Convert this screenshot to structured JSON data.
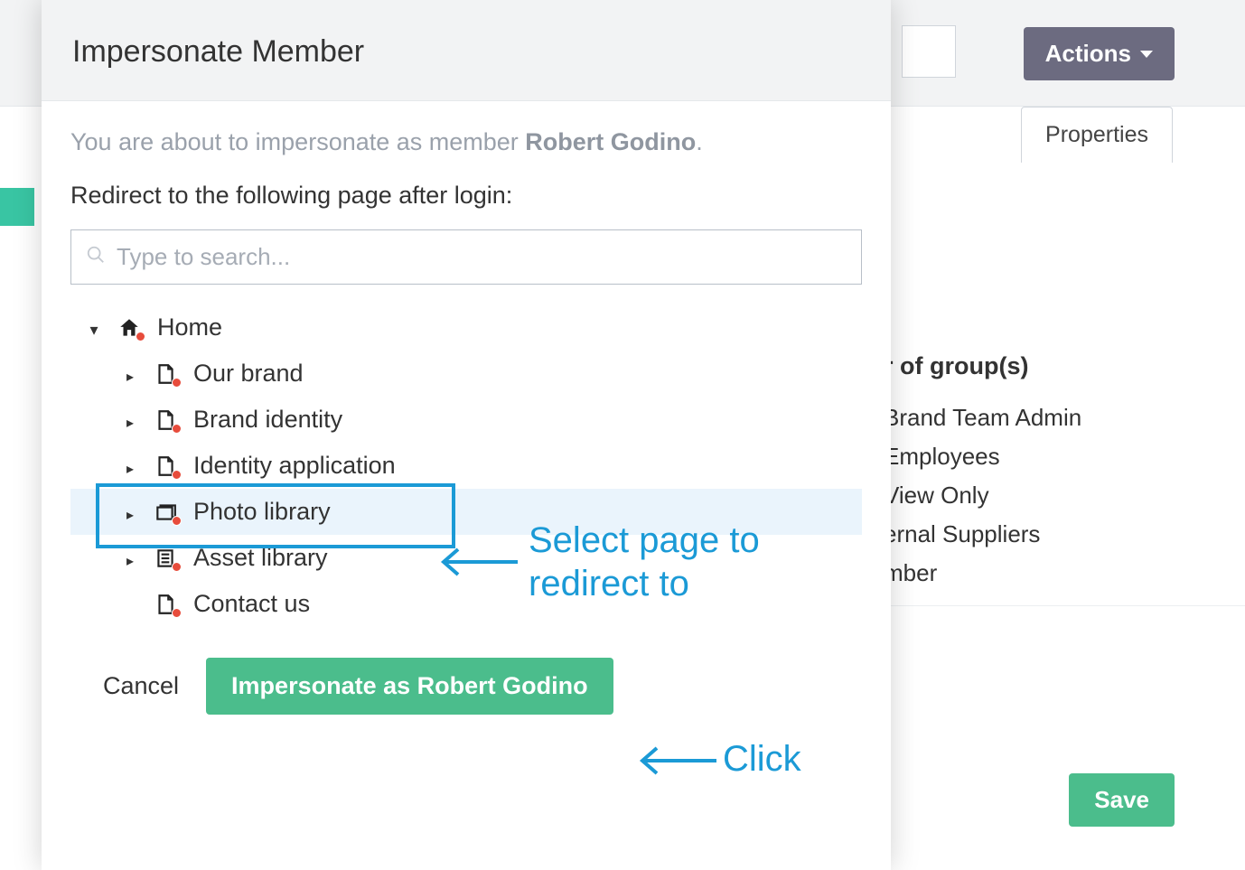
{
  "background": {
    "actions_label": "Actions",
    "properties_tab": "Properties",
    "groups_title": "r of group(s)",
    "groups": [
      "Brand Team Admin",
      "Employees",
      "View Only",
      "ernal Suppliers",
      "mber"
    ],
    "save_label": "Save"
  },
  "modal": {
    "title": "Impersonate Member",
    "intro_prefix": "You are about to impersonate as member ",
    "member_name": "Robert Godino",
    "intro_suffix": ".",
    "redirect_label": "Redirect to the following page after login:",
    "search_placeholder": "Type to search...",
    "tree": {
      "root": "Home",
      "children": [
        "Our brand",
        "Brand identity",
        "Identity application",
        "Photo library",
        "Asset library",
        "Contact us"
      ]
    },
    "cancel_label": "Cancel",
    "impersonate_label": "Impersonate as Robert Godino"
  },
  "annotations": {
    "select_page": "Select page to redirect to",
    "click": "Click"
  }
}
